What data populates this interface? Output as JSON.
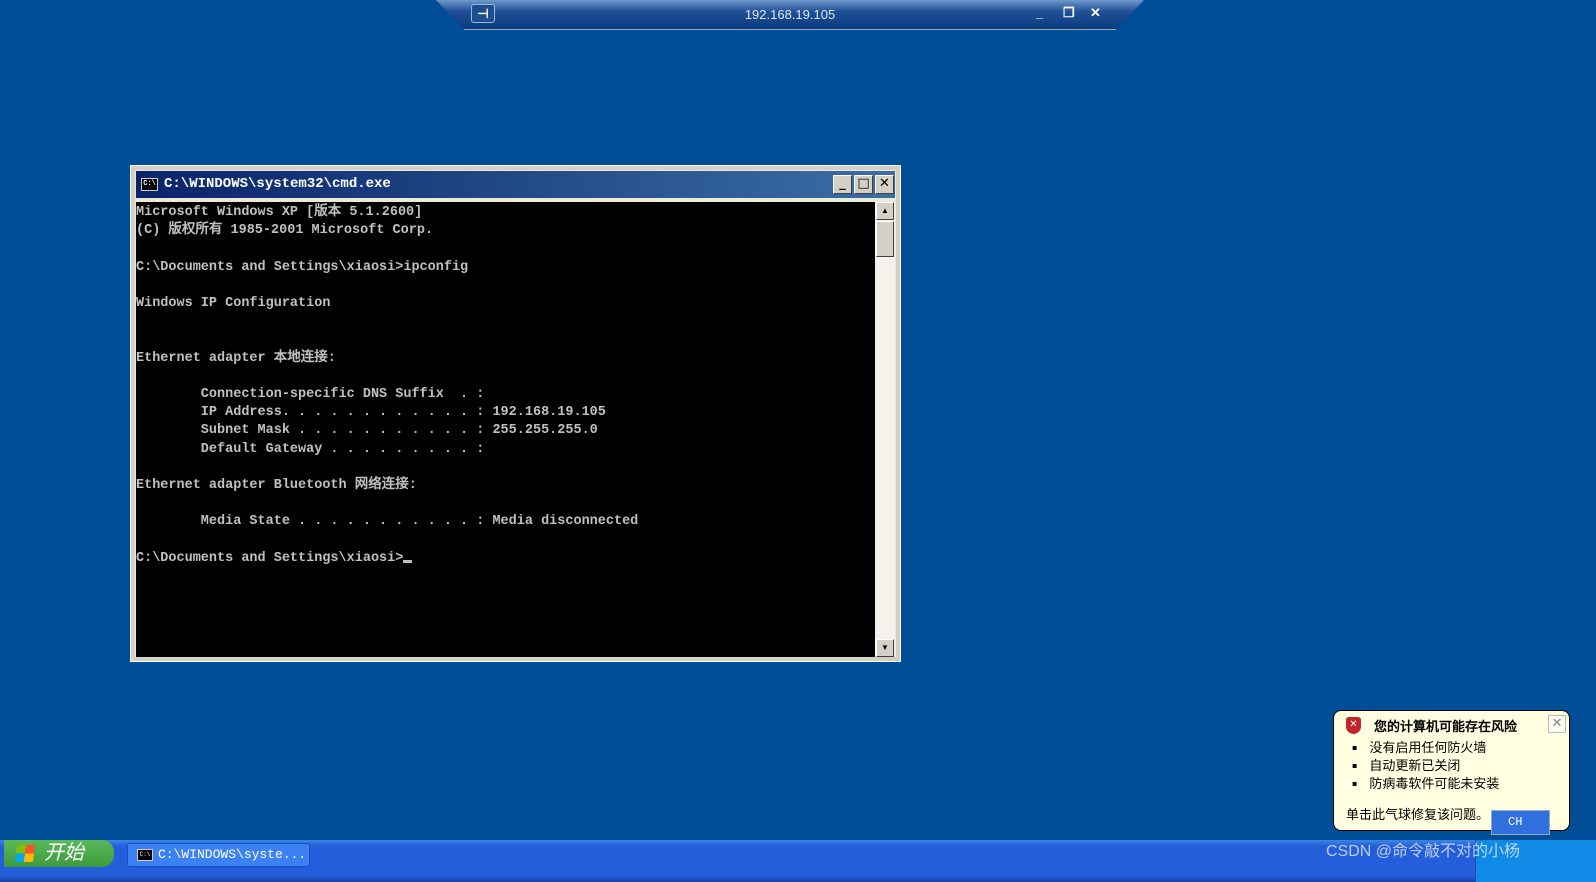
{
  "remote_bar": {
    "host": "192.168.19.105",
    "pin_icon": "pin-icon",
    "minimize": "_",
    "restore": "❐",
    "close": "✕"
  },
  "cmd": {
    "title": "C:\\WINDOWS\\system32\\cmd.exe",
    "icon_text": "C:\\",
    "lines": [
      "Microsoft Windows XP [版本 5.1.2600]",
      "(C) 版权所有 1985-2001 Microsoft Corp.",
      "",
      "C:\\Documents and Settings\\xiaosi>ipconfig",
      "",
      "Windows IP Configuration",
      "",
      "",
      "Ethernet adapter 本地连接:",
      "",
      "        Connection-specific DNS Suffix  . :",
      "        IP Address. . . . . . . . . . . . : 192.168.19.105",
      "        Subnet Mask . . . . . . . . . . . : 255.255.255.0",
      "        Default Gateway . . . . . . . . . :",
      "",
      "Ethernet adapter Bluetooth 网络连接:",
      "",
      "        Media State . . . . . . . . . . . : Media disconnected",
      "",
      "C:\\Documents and Settings\\xiaosi>"
    ]
  },
  "taskbar": {
    "start_label": "开始",
    "task_button": "C:\\WINDOWS\\syste...",
    "ime": "CH"
  },
  "balloon": {
    "title": "您的计算机可能存在风险",
    "items": [
      "没有启用任何防火墙",
      "自动更新已关闭",
      "防病毒软件可能未安装"
    ],
    "action": "单击此气球修复该问题。"
  },
  "watermark": "CSDN @命令敲不对的小杨"
}
